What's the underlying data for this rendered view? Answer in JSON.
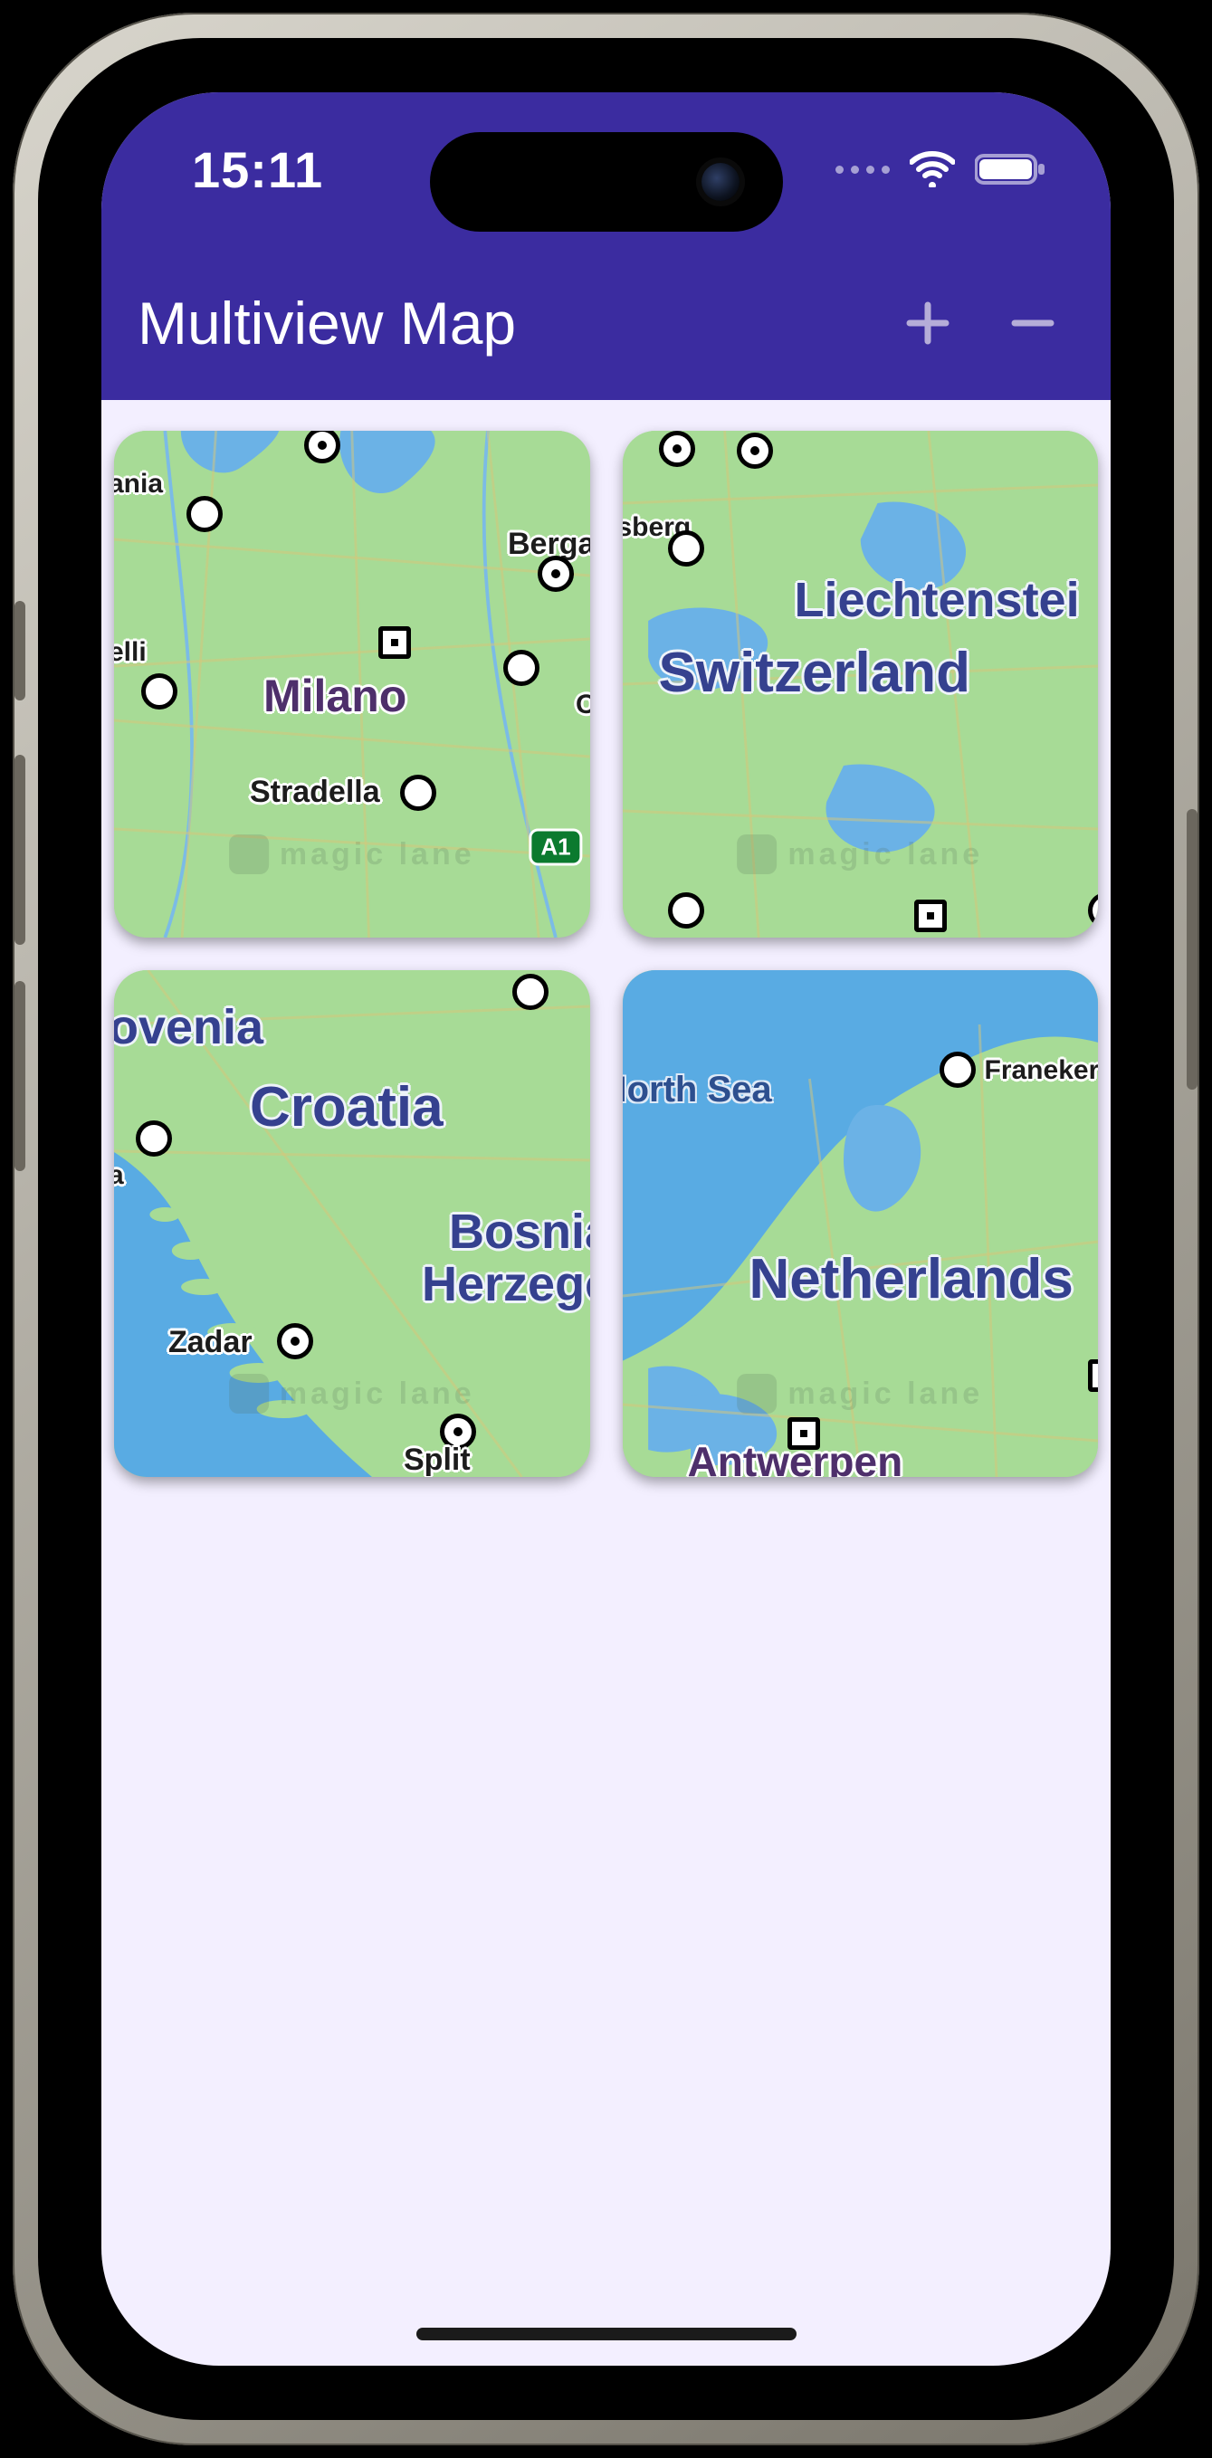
{
  "status": {
    "time": "15:11"
  },
  "header": {
    "title": "Multiview Map"
  },
  "watermark": "magic lane",
  "roadBadge": "A1",
  "maps": [
    {
      "id": "milano",
      "labels": {
        "major_city": "Milano",
        "frag_ania": "ania",
        "bergamo_frag": "Bergai",
        "frag_elli": "elli",
        "stradella": "Stradella",
        "frag_or": "Or"
      }
    },
    {
      "id": "switzerland",
      "labels": {
        "country1": "Switzerland",
        "country2_frag": "Liechtenstei",
        "sberg_frag": "sberg"
      }
    },
    {
      "id": "croatia",
      "labels": {
        "country": "Croatia",
        "country_frag": "ovenia",
        "bosnia_l1": "Bosnia",
        "bosnia_l2": "Herzego",
        "zadar": "Zadar",
        "split": "Split",
        "frag_a": "a"
      }
    },
    {
      "id": "netherlands",
      "labels": {
        "country": "Netherlands",
        "sea_frag": "Iorth Sea",
        "franeker": "Franeker",
        "antwerpen": "Antwerpen"
      }
    }
  ]
}
